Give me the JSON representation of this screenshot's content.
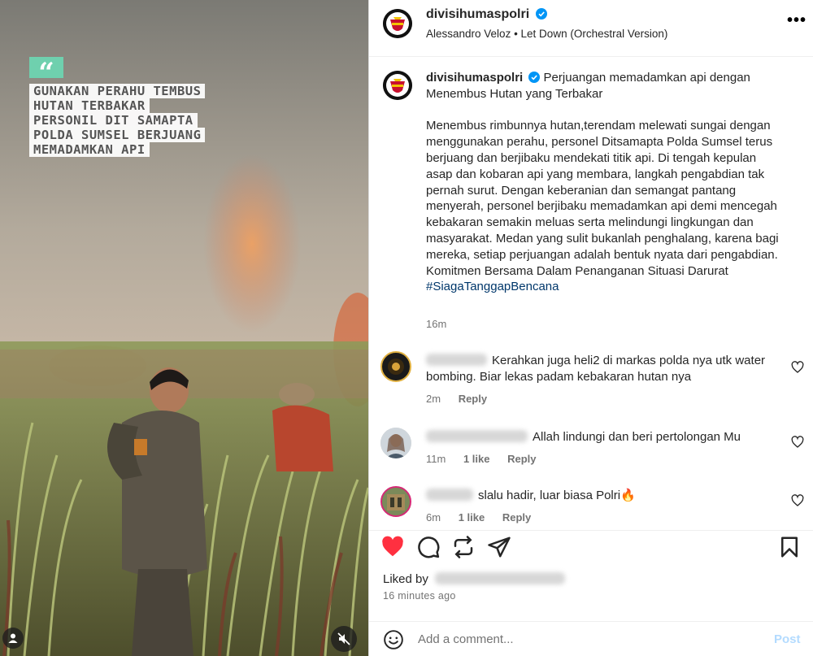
{
  "post": {
    "username": "divisihumaspolri",
    "audio": "Alessandro Veloz • Let Down (Orchestral Version)",
    "caption_title": "Perjuangan memadamkan api dengan Menembus Hutan yang Terbakar",
    "caption_body": "Menembus rimbunnya hutan,terendam melewati sungai dengan menggunakan perahu, personel Ditsamapta Polda Sumsel terus berjuang dan berjibaku mendekati titik api. Di tengah kepulan asap dan kobaran api yang membara, langkah pengabdian tak pernah surut. Dengan keberanian dan semangat pantang menyerah, personel berjibaku memadamkan api demi mencegah kebakaran semakin meluas serta melindungi lingkungan dan masyarakat. Medan yang sulit bukanlah penghalang, karena bagi mereka, setiap perjuangan adalah bentuk nyata dari pengabdian. Komitmen Bersama Dalam Penanganan Situasi Darurat",
    "hashtag": "#SiagaTanggapBencana",
    "time": "16m"
  },
  "media": {
    "quote_mark": "“",
    "overlay_lines": [
      "GUNAKAN PERAHU TEMBUS",
      "HUTAN TERBAKAR",
      "PERSONIL DIT SAMAPTA",
      "POLDA SUMSEL BERJUANG",
      "MEMADAMKAN API"
    ]
  },
  "comments": [
    {
      "text": "Kerahkan juga heli2 di markas polda nya utk water bombing. Biar lekas padam kebakaran hutan nya",
      "time": "2m",
      "likes": "",
      "reply": "Reply"
    },
    {
      "text": "Allah lindungi dan beri pertolongan Mu",
      "time": "11m",
      "likes": "1 like",
      "reply": "Reply"
    },
    {
      "text": "slalu hadir, luar biasa Polri🔥",
      "time": "6m",
      "likes": "1 like",
      "reply": "Reply"
    }
  ],
  "footer": {
    "liked_by": "Liked by",
    "liked_time": "16 minutes ago",
    "comment_placeholder": "Add a comment...",
    "post_label": "Post"
  },
  "colors": {
    "like_red": "#ff3040",
    "link_blue": "#00376b",
    "verified_blue": "#0095f6",
    "post_button_disabled": "#b3dbff"
  },
  "icons": [
    "more-icon",
    "verified-icon",
    "heart-icon",
    "comment-icon",
    "share-icon",
    "send-icon",
    "save-icon",
    "emoji-icon",
    "mute-icon",
    "user-tag-icon"
  ]
}
